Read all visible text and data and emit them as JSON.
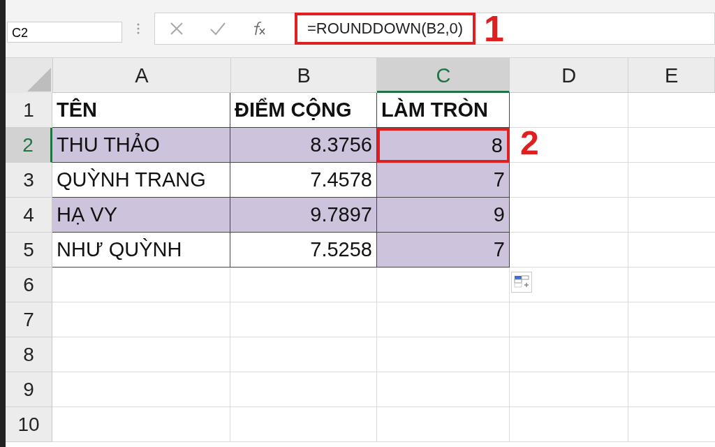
{
  "formula_bar": {
    "name_box": "C2",
    "formula": "=ROUNDDOWN(B2,0)",
    "callout": "1"
  },
  "columns": [
    {
      "label": "A",
      "selected": false
    },
    {
      "label": "B",
      "selected": false
    },
    {
      "label": "C",
      "selected": true
    },
    {
      "label": "D",
      "selected": false
    },
    {
      "label": "E",
      "selected": false
    }
  ],
  "rows": [
    {
      "label": "1",
      "selected": false,
      "kind": "header",
      "cells": [
        {
          "text": "TÊN",
          "highlighted": false,
          "kind": "text"
        },
        {
          "text": "ĐIỂM CỘNG",
          "highlighted": false,
          "kind": "text"
        },
        {
          "text": "LÀM TRÒN",
          "highlighted": false,
          "kind": "text"
        }
      ]
    },
    {
      "label": "2",
      "selected": true,
      "kind": "data",
      "cells": [
        {
          "text": "THU THẢO",
          "highlighted": true,
          "kind": "text"
        },
        {
          "text": "8.3756",
          "highlighted": true,
          "kind": "number"
        },
        {
          "text": "8",
          "highlighted": true,
          "kind": "number",
          "callout": "2"
        }
      ]
    },
    {
      "label": "3",
      "selected": false,
      "kind": "data",
      "cells": [
        {
          "text": "QUỲNH TRANG",
          "highlighted": false,
          "kind": "text"
        },
        {
          "text": "7.4578",
          "highlighted": false,
          "kind": "number"
        },
        {
          "text": "7",
          "highlighted": true,
          "kind": "number"
        }
      ]
    },
    {
      "label": "4",
      "selected": false,
      "kind": "data",
      "cells": [
        {
          "text": "HẠ VY",
          "highlighted": true,
          "kind": "text"
        },
        {
          "text": "9.7897",
          "highlighted": true,
          "kind": "number"
        },
        {
          "text": "9",
          "highlighted": true,
          "kind": "number"
        }
      ]
    },
    {
      "label": "5",
      "selected": false,
      "kind": "data",
      "cells": [
        {
          "text": "NHƯ QUỲNH",
          "highlighted": false,
          "kind": "text"
        },
        {
          "text": "7.5258",
          "highlighted": false,
          "kind": "number"
        },
        {
          "text": "7",
          "highlighted": true,
          "kind": "number"
        }
      ]
    },
    {
      "label": "6",
      "selected": false,
      "cells": []
    },
    {
      "label": "7",
      "selected": false,
      "cells": []
    },
    {
      "label": "8",
      "selected": false,
      "cells": []
    },
    {
      "label": "9",
      "selected": false,
      "cells": []
    },
    {
      "label": "10",
      "selected": false,
      "cells": []
    }
  ]
}
